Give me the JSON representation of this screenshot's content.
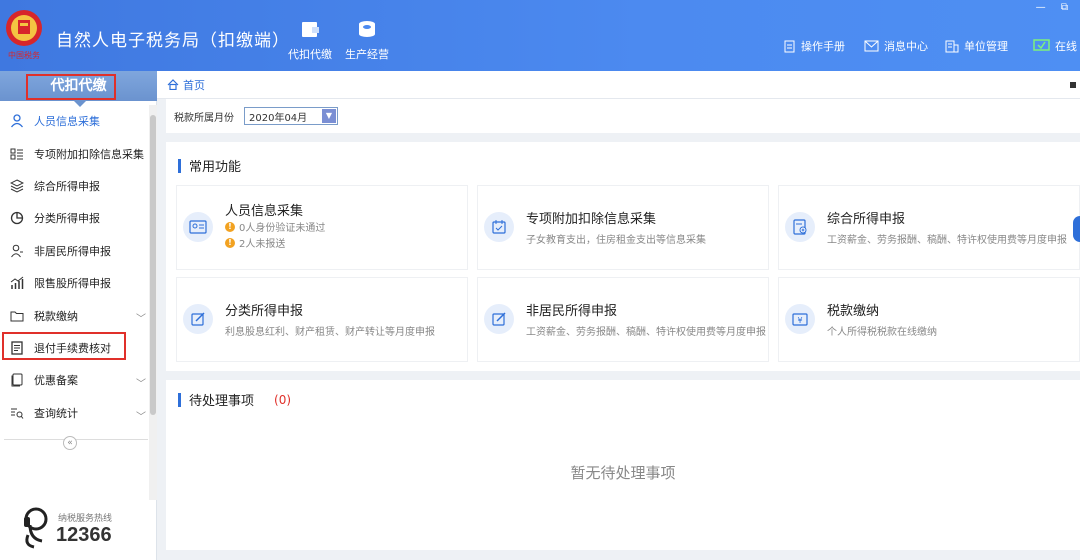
{
  "header": {
    "title": "自然人电子税务局（扣缴端）",
    "nav": [
      {
        "label": "代扣代缴",
        "icon": "wallet-icon"
      },
      {
        "label": "生产经营",
        "icon": "coins-icon"
      }
    ],
    "right_links": [
      {
        "label": "操作手册",
        "icon": "document-icon"
      },
      {
        "label": "消息中心",
        "icon": "mail-icon"
      },
      {
        "label": "单位管理",
        "icon": "building-icon"
      },
      {
        "label": "在线",
        "icon": "check-monitor-icon"
      }
    ],
    "window_controls": "— ⧉"
  },
  "sidebar": {
    "header": "代扣代缴",
    "items": [
      {
        "label": "人员信息采集",
        "icon": "person-icon",
        "active": true
      },
      {
        "label": "专项附加扣除信息采集",
        "icon": "list-icon"
      },
      {
        "label": "综合所得申报",
        "icon": "layers-icon"
      },
      {
        "label": "分类所得申报",
        "icon": "pie-icon"
      },
      {
        "label": "非居民所得申报",
        "icon": "user-outline-icon"
      },
      {
        "label": "限售股所得申报",
        "icon": "bar-chart-icon"
      },
      {
        "label": "税款缴纳",
        "icon": "folder-icon",
        "expandable": true
      },
      {
        "label": "退付手续费核对",
        "icon": "receipt-icon",
        "highlighted": true
      },
      {
        "label": "优惠备案",
        "icon": "doc-copy-icon",
        "expandable": true
      },
      {
        "label": "查询统计",
        "icon": "search-list-icon",
        "expandable": true
      }
    ],
    "collapse_glyph": "«",
    "hotline_label": "纳税服务热线",
    "hotline_number": "12366"
  },
  "breadcrumb": {
    "home": "首页"
  },
  "filter": {
    "label": "税款所属月份",
    "month": "2020年04月"
  },
  "common": {
    "title": "常用功能",
    "cards": [
      {
        "title": "人员信息采集",
        "desc": "",
        "warnings": [
          "0人身份验证未通过",
          "2人未报送"
        ],
        "icon": "id-card-icon"
      },
      {
        "title": "专项附加扣除信息采集",
        "desc": "子女教育支出，住房租金支出等信息采集",
        "icon": "calendar-check-icon"
      },
      {
        "title": "综合所得申报",
        "desc": "工资薪金、劳务报酬、稿酬、特许权使用费等月度申报",
        "icon": "form-add-icon"
      },
      {
        "title": "分类所得申报",
        "desc": "利息股息红利、财产租赁、财产转让等月度申报",
        "icon": "edit-icon"
      },
      {
        "title": "非居民所得申报",
        "desc": "工资薪金、劳务报酬、稿酬、特许权使用费等月度申报",
        "icon": "edit-icon"
      },
      {
        "title": "税款缴纳",
        "desc": "个人所得税税款在线缴纳",
        "icon": "payment-icon"
      }
    ]
  },
  "pending": {
    "title": "待处理事项",
    "count": "(0)",
    "empty": "暂无待处理事项"
  },
  "colors": {
    "accent": "#2e6fd9",
    "header": "#4c8af0",
    "warning": "#f2a221",
    "highlight": "#e0302a"
  }
}
